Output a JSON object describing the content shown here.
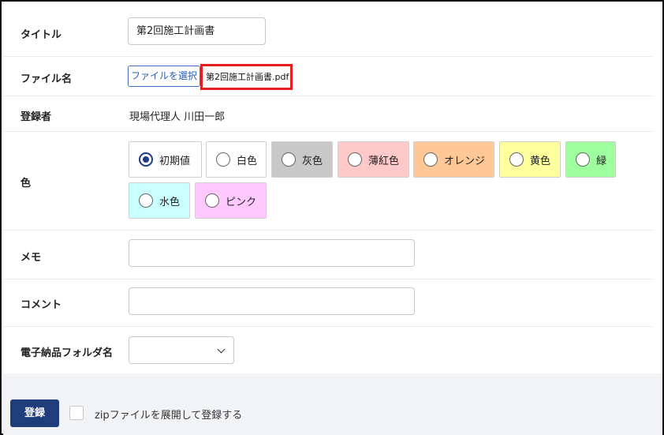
{
  "form": {
    "title": {
      "label": "タイトル",
      "value": "第2回施工計画書"
    },
    "file": {
      "label": "ファイル名",
      "button_label": "ファイルを選択",
      "selected_file": "第2回施工計画書.pdf"
    },
    "registrant": {
      "label": "登録者",
      "value": "現場代理人 川田一郎"
    },
    "color": {
      "label": "色",
      "options": [
        {
          "label": "初期値",
          "bg": "#ffffff",
          "checked": true
        },
        {
          "label": "白色",
          "bg": "#ffffff",
          "checked": false
        },
        {
          "label": "灰色",
          "bg": "#c8c8c8",
          "checked": false
        },
        {
          "label": "薄紅色",
          "bg": "#ffc9c9",
          "checked": false
        },
        {
          "label": "オレンジ",
          "bg": "#ffc896",
          "checked": false
        },
        {
          "label": "黄色",
          "bg": "#ffff9e",
          "checked": false
        },
        {
          "label": "緑",
          "bg": "#9eff9e",
          "checked": false
        },
        {
          "label": "水色",
          "bg": "#c9ffff",
          "checked": false
        },
        {
          "label": "ピンク",
          "bg": "#ffc9ff",
          "checked": false
        }
      ]
    },
    "memo": {
      "label": "メモ",
      "value": ""
    },
    "comment": {
      "label": "コメント",
      "value": ""
    },
    "folder": {
      "label": "電子納品フォルダ名",
      "selected": ""
    }
  },
  "footer": {
    "submit_label": "登録",
    "zip_checkbox_label": "zipファイルを展開して登録する",
    "zip_checked": false
  },
  "colors": {
    "primary": "#1f3d7a",
    "link_blue": "#2a5db0",
    "highlight_red": "#e31f1f",
    "footer_bg": "#f2f3f6"
  }
}
